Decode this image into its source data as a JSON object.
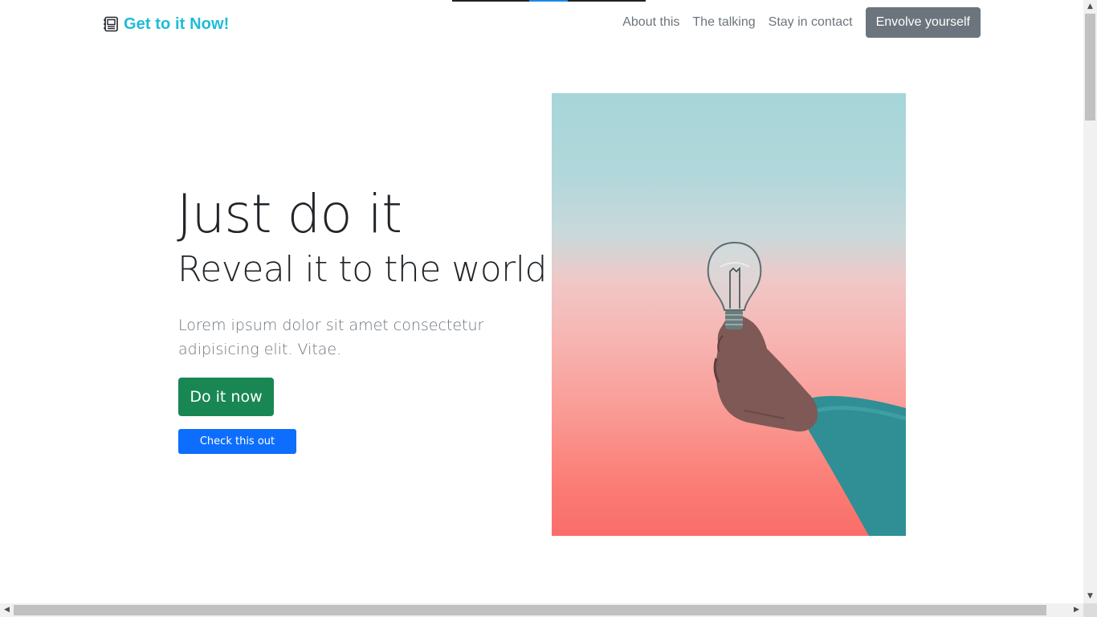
{
  "navbar": {
    "brand": {
      "text": "Get to it Now!",
      "icon": "journal-icon",
      "color": "#1ebcd8"
    },
    "links": [
      {
        "label": "About this"
      },
      {
        "label": "The talking"
      },
      {
        "label": "Stay in contact"
      }
    ],
    "cta_label": "Envolve yourself"
  },
  "hero": {
    "title": "Just do it",
    "subtitle": "Reveal it to the world",
    "description": "Lorem ipsum dolor sit amet consectetur adipisicing elit. Vitae.",
    "primary_button": "Do it now",
    "secondary_button": "Check this out",
    "image_icon": "lightbulb-in-hand-image"
  },
  "colors": {
    "primary_button": "#198754",
    "secondary_button": "#0d6efd",
    "nav_button": "#6c757d",
    "brand": "#1ebcd8"
  },
  "scrollbars": {
    "up_icon": "▲",
    "down_icon": "▼",
    "left_icon": "◀",
    "right_icon": "▶"
  }
}
